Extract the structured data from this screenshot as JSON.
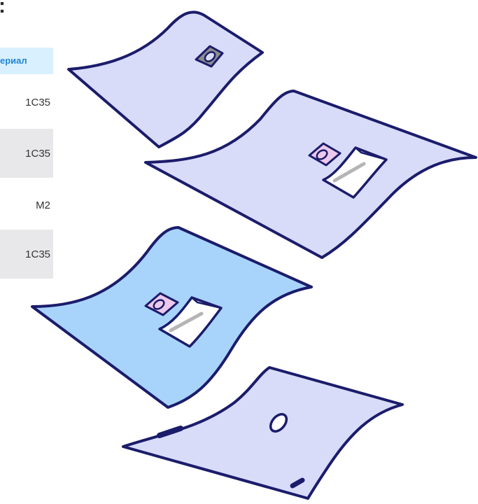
{
  "heading": {
    "fragment": ":"
  },
  "table": {
    "header_label": "ериал",
    "rows": [
      {
        "value": "1С35",
        "shaded": false
      },
      {
        "value": "1С35",
        "shaded": true
      },
      {
        "value": "М2",
        "shaded": false
      },
      {
        "value": "1С35",
        "shaded": true
      }
    ]
  },
  "illustrations": {
    "colors": {
      "outline": "#1b1c6b",
      "drape_lavender": "#d9dcf9",
      "drape_blue": "#a8d4fb",
      "fenestration_grey": "#8c8c8c",
      "fenestration_pink": "#ecc9ec",
      "pouch_white": "#ffffff",
      "pouch_stripe": "#b5b5b5"
    },
    "items": [
      "drape-with-grey-fenestration",
      "drape-with-pouch-1",
      "drape-with-pouch-blue",
      "drape-with-hole"
    ]
  }
}
